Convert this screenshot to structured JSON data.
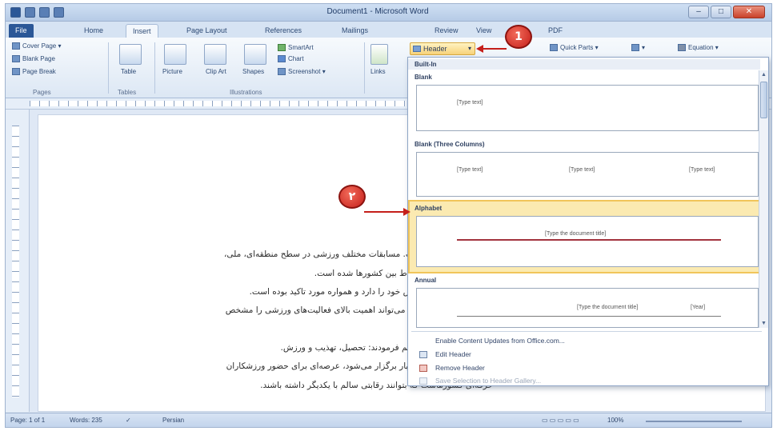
{
  "window": {
    "title": "Document1 - Microsoft Word",
    "controls": [
      "–",
      "□",
      "✕"
    ]
  },
  "tabs": [
    "File",
    "Home",
    "Insert",
    "Page Layout",
    "References",
    "Mailings",
    "Review",
    "View",
    "PDF"
  ],
  "ribbon": {
    "pages_group": {
      "items": [
        "Cover Page ▾",
        "Blank Page",
        "Page Break"
      ],
      "label": "Pages"
    },
    "tables": {
      "label": "Table",
      "group": "Tables"
    },
    "illustrations": {
      "items": [
        "Picture",
        "Clip Art",
        "Shapes",
        "SmartArt",
        "Chart",
        "Screenshot ▾"
      ],
      "group": "Illustrations"
    },
    "links": {
      "label": "Links"
    },
    "header_button": "Header",
    "text_group": [
      "Quick Parts ▾",
      "Equation ▾"
    ]
  },
  "dropdown": {
    "section_title": "Built-In",
    "templates": [
      {
        "name": "Blank",
        "placeholders": [
          "[Type text]"
        ]
      },
      {
        "name": "Blank (Three Columns)",
        "placeholders": [
          "[Type text]",
          "[Type text]",
          "[Type text]"
        ]
      },
      {
        "name": "Alphabet",
        "placeholders": [
          "[Type the document title]"
        ]
      },
      {
        "name": "Annual",
        "placeholders": [
          "[Type the document title]",
          "[Year]"
        ]
      }
    ],
    "menu": [
      {
        "label": "Enable Content Updates from Office.com...",
        "enabled": true
      },
      {
        "label": "Edit Header",
        "enabled": true
      },
      {
        "label": "Remove Header",
        "enabled": true
      },
      {
        "label": "Save Selection to Header Gallery...",
        "enabled": false
      }
    ]
  },
  "callouts": [
    "1",
    "۲"
  ],
  "document": {
    "lines": [
      "ست. مسابقات مختلف ورزشی در سطح منطقه‌ای، ملی،",
      "ارتباط بین کشورها شده است.",
      "خاص خود را دارد و همواره مورد تاکید بوده است.",
      "ازی می‌تواند اهمیت بالای فعالیت‌های ورزشی را مشخص",
      "رسیم فرمودند: تحصیل، تهذیب و ورزش.",
      "یک بار برگزار می‌شود، عرصه‌ای برای حضور ورزشکاران",
      "حرفه‌ای کشورهاست که بتوانند رقابتی سالم با یکدیگر داشته باشند."
    ]
  },
  "statusbar": {
    "page": "Page: 1 of 1",
    "words": "Words: 235",
    "language": "Persian",
    "zoom": "100%"
  },
  "colors": {
    "accent": "#2b5797",
    "highlight": "#fbeab1",
    "callout": "#c51f1a"
  }
}
